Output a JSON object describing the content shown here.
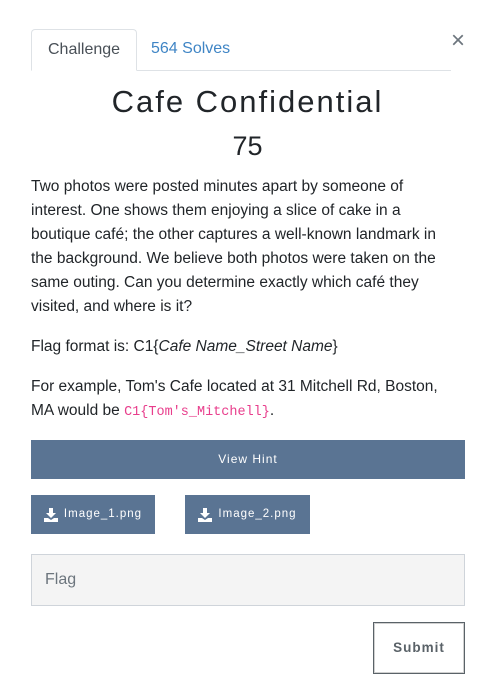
{
  "modal": {
    "close_label": "×"
  },
  "tabs": [
    {
      "label": "Challenge"
    },
    {
      "label": "564 Solves"
    }
  ],
  "challenge": {
    "title": "Cafe Confidential",
    "points": "75",
    "description": "Two photos were posted minutes apart by someone of interest. One shows them enjoying a slice of cake in a boutique café; the other captures a well-known landmark in the background. We believe both photos were taken on the same outing. Can you determine exactly which café they visited, and where is it?",
    "flag_format_prefix": "Flag format is: C1{",
    "flag_format_italic": "Cafe Name_Street Name",
    "flag_format_suffix": "}",
    "example_prefix": "For example, Tom's Cafe located at 31 Mitchell Rd, Boston, MA would be ",
    "example_code": "C1{Tom's_Mitchell}",
    "example_suffix": "."
  },
  "buttons": {
    "hint": "View Hint",
    "file1": "Image_1.png",
    "file2": "Image_2.png",
    "submit": "Submit"
  },
  "flag_input": {
    "placeholder": "Flag",
    "value": ""
  },
  "colors": {
    "button_bg": "#5a7493",
    "tab_link": "#3f85c5",
    "code_pink": "#e83e8c"
  },
  "icons": {
    "close": "close-icon",
    "download": "download-icon"
  }
}
